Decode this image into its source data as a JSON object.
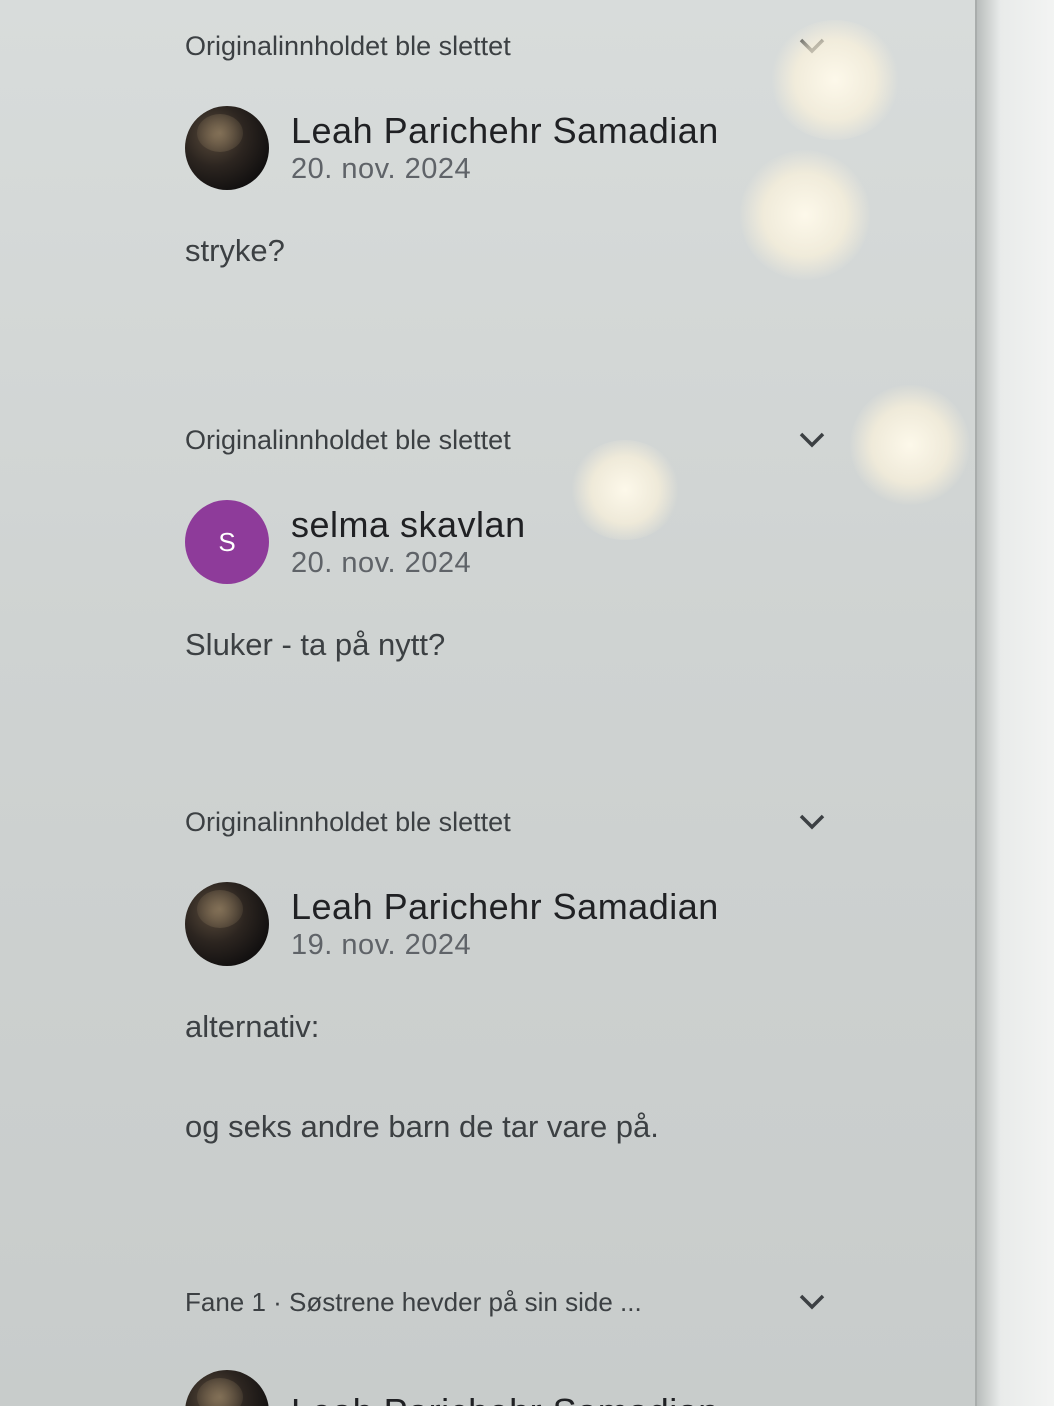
{
  "threads": [
    {
      "quote": "Originalinnholdet ble slettet",
      "author": "Leah Parichehr Samadian",
      "date": "20. nov. 2024",
      "avatar": "photo",
      "body": [
        "stryke?"
      ]
    },
    {
      "quote": "Originalinnholdet ble slettet",
      "author": "selma skavlan",
      "date": "20. nov. 2024",
      "avatar": "letter",
      "avatar_letter": "S",
      "avatar_color": "#8e3b9a",
      "body": [
        "Sluker - ta på nytt?"
      ]
    },
    {
      "quote": "Originalinnholdet ble slettet",
      "author": "Leah Parichehr Samadian",
      "date": "19. nov. 2024",
      "avatar": "photo",
      "body": [
        "alternativ:",
        "og seks andre barn de tar vare på."
      ]
    },
    {
      "quote": "Fane 1 · Søstrene hevder på sin side ...",
      "author": "Leah Parichehr Samadian",
      "avatar": "photo"
    }
  ]
}
